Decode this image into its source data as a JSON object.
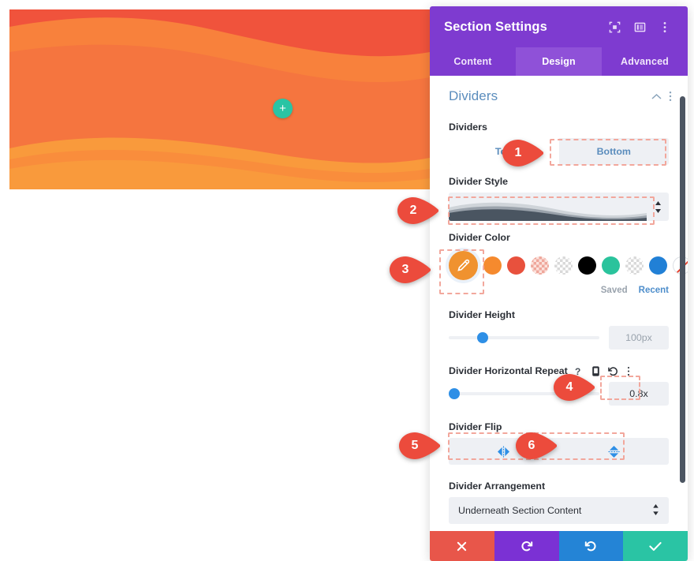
{
  "preview": {
    "add_button_label": "+",
    "add_button_icon": "plus-icon",
    "colors": {
      "band_top": "#f0533c",
      "band_mid": "#f8813c",
      "band_base": "#f5753f",
      "band_bottom": "#f99a3c",
      "add_button": "#2ac4a4"
    }
  },
  "panel": {
    "title": "Section Settings",
    "header_icons": [
      "expand-icon",
      "layout-columns-icon",
      "more-vertical-icon"
    ],
    "tabs": [
      {
        "label": "Content",
        "active": false
      },
      {
        "label": "Design",
        "active": true
      },
      {
        "label": "Advanced",
        "active": false
      }
    ],
    "group": {
      "title": "Dividers",
      "collapse_icon": "chevron-up-icon",
      "more_icon": "more-vertical-icon"
    },
    "fields": {
      "dividers": {
        "label": "Dividers",
        "options": [
          "Top",
          "Bottom"
        ],
        "selected": "Top"
      },
      "divider_style": {
        "label": "Divider Style",
        "control_icon": "spinner-updown-icon"
      },
      "divider_color": {
        "label": "Divider Color",
        "active_swatch_icon": "eyedropper-icon",
        "active_color": "#f0922f",
        "swatches": [
          {
            "name": "orange",
            "color": "#f58a2e",
            "kind": "solid"
          },
          {
            "name": "tomato",
            "color": "#e8513d",
            "kind": "solid"
          },
          {
            "name": "pink-transparent",
            "color": "#efa79b",
            "kind": "checker"
          },
          {
            "name": "gray-transparent",
            "color": "#d9d9d9",
            "kind": "checker"
          },
          {
            "name": "black",
            "color": "#000000",
            "kind": "solid"
          },
          {
            "name": "teal",
            "color": "#2ac39c",
            "kind": "solid"
          },
          {
            "name": "light-transparent",
            "color": "#e2e2e2",
            "kind": "checker"
          },
          {
            "name": "blue",
            "color": "#2180d6",
            "kind": "solid"
          },
          {
            "name": "none",
            "color": "#ffffff",
            "kind": "none"
          }
        ],
        "links": {
          "saved": "Saved",
          "recent": "Recent"
        }
      },
      "divider_height": {
        "label": "Divider Height",
        "value": "100px",
        "slider_percent": 21
      },
      "divider_horizontal_repeat": {
        "label": "Divider Horizontal Repeat",
        "icons": [
          "help-icon",
          "mobile-icon",
          "reset-icon",
          "more-vertical-icon"
        ],
        "value": "0.8x",
        "slider_percent": 2
      },
      "divider_flip": {
        "label": "Divider Flip",
        "options": [
          {
            "name": "flip-horizontal-icon"
          },
          {
            "name": "flip-vertical-icon"
          }
        ]
      },
      "divider_arrangement": {
        "label": "Divider Arrangement",
        "value": "Underneath Section Content",
        "caret_icon": "select-caret-icon"
      }
    },
    "footer": [
      {
        "name": "cancel-button",
        "icon": "close-icon",
        "color": "#e8564a"
      },
      {
        "name": "undo-button",
        "icon": "undo-icon",
        "color": "#7b31d4"
      },
      {
        "name": "redo-button",
        "icon": "redo-icon",
        "color": "#2484d6"
      },
      {
        "name": "save-button",
        "icon": "check-icon",
        "color": "#2ac4a4"
      }
    ]
  },
  "callouts": [
    {
      "number": "1"
    },
    {
      "number": "2"
    },
    {
      "number": "3"
    },
    {
      "number": "4"
    },
    {
      "number": "5"
    },
    {
      "number": "6"
    }
  ]
}
